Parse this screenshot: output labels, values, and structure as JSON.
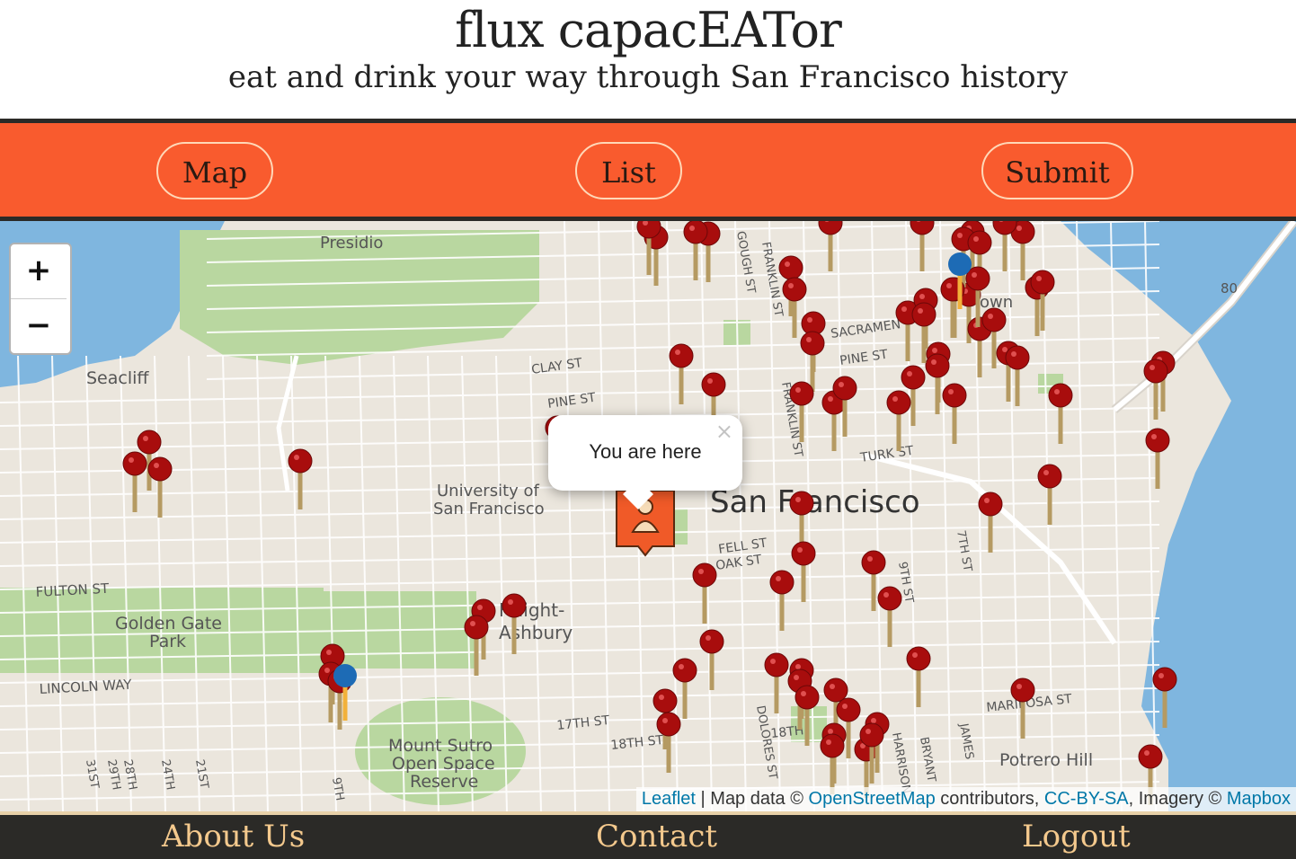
{
  "header": {
    "title": "flux capacEATor",
    "subtitle": "eat and drink your way through San Francisco history"
  },
  "nav": {
    "map_label": "Map",
    "list_label": "List",
    "submit_label": "Submit"
  },
  "map": {
    "zoom_in": "+",
    "zoom_out": "−",
    "popup_text": "You are here",
    "popup_close": "×",
    "labels": {
      "presidio": "Presidio",
      "seacliff": "Seacliff",
      "clay": "CLAY ST",
      "pine_west": "PINE ST",
      "pine_east": "PINE ST",
      "sacramento": "SACRAMEN",
      "turk": "TURK ST",
      "usf1": "University of",
      "usf2": "San Francisco",
      "sf": "San Francisco",
      "fell": "FELL ST",
      "oak": "OAK ST",
      "fulton": "FULTON ST",
      "gg1": "Golden Gate",
      "gg2": "Park",
      "haight1": "Haight-",
      "haight2": "Ashbury",
      "lincoln": "LINCOLN WAY",
      "sutro1": "Mount Sutro",
      "sutro2": "Open Space",
      "sutro3": "Reserve",
      "mariposa": "MARIPOSA ST",
      "potrero": "Potrero Hill",
      "s17th": "17TH ST",
      "s18th_w": "18TH ST",
      "s18th_e": "18TH",
      "gough": "GOUGH ST",
      "franklin": "FRANKLIN ST",
      "franklin2": "FRANKLIN ST",
      "s7th": "7TH ST",
      "s9th": "9TH ST",
      "dolores": "DOLORES ST",
      "harrison": "HARRISON",
      "bryant": "BRYANT",
      "james": "JAMES",
      "town": "own",
      "i80": "80",
      "s9th_ave": "9TH",
      "s21st": "21ST",
      "s24th": "24TH",
      "s28th": "28TH",
      "s29th": "29TH",
      "s31st": "31ST"
    },
    "attribution": {
      "leaflet": "Leaflet",
      "map_data": " | Map data © ",
      "osm": "OpenStreetMap",
      "contributors": " contributors, ",
      "license": "CC-BY-SA",
      "imagery": ", Imagery © ",
      "mapbox": "Mapbox"
    },
    "colors": {
      "water": "#7fb6df",
      "land": "#ebe6dd",
      "park": "#b9d7a0",
      "pin": "#a80d0d",
      "pin_stick": "#b59a62",
      "blue_pin": "#1d6bb5",
      "user_marker": "#f05a28"
    },
    "marker_count": 108
  },
  "footer": {
    "about": "About Us",
    "contact": "Contact",
    "logout": "Logout"
  }
}
